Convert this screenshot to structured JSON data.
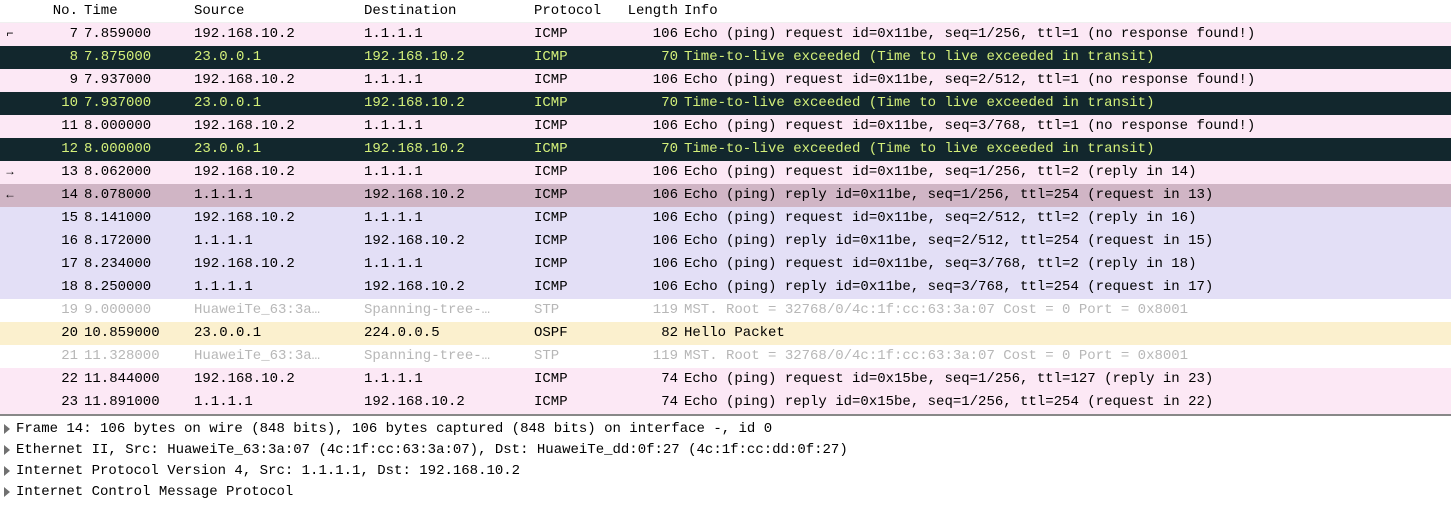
{
  "columns": {
    "no": "No.",
    "time": "Time",
    "source": "Source",
    "destination": "Destination",
    "protocol": "Protocol",
    "length": "Length",
    "info": "Info"
  },
  "rows": [
    {
      "marker": "⌐",
      "no": "7",
      "time": "7.859000",
      "src": "192.168.10.2",
      "dst": "1.1.1.1",
      "proto": "ICMP",
      "len": "106",
      "info": "Echo (ping) request  id=0x11be, seq=1/256, ttl=1 (no response found!)",
      "cls": "bg-pink"
    },
    {
      "marker": "",
      "no": "8",
      "time": "7.875000",
      "src": "23.0.0.1",
      "dst": "192.168.10.2",
      "proto": "ICMP",
      "len": "70",
      "info": "Time-to-live exceeded (Time to live exceeded in transit)",
      "cls": "bg-dark"
    },
    {
      "marker": "",
      "no": "9",
      "time": "7.937000",
      "src": "192.168.10.2",
      "dst": "1.1.1.1",
      "proto": "ICMP",
      "len": "106",
      "info": "Echo (ping) request  id=0x11be, seq=2/512, ttl=1 (no response found!)",
      "cls": "bg-pink"
    },
    {
      "marker": "",
      "no": "10",
      "time": "7.937000",
      "src": "23.0.0.1",
      "dst": "192.168.10.2",
      "proto": "ICMP",
      "len": "70",
      "info": "Time-to-live exceeded (Time to live exceeded in transit)",
      "cls": "bg-dark"
    },
    {
      "marker": "",
      "no": "11",
      "time": "8.000000",
      "src": "192.168.10.2",
      "dst": "1.1.1.1",
      "proto": "ICMP",
      "len": "106",
      "info": "Echo (ping) request  id=0x11be, seq=3/768, ttl=1 (no response found!)",
      "cls": "bg-pink"
    },
    {
      "marker": "",
      "no": "12",
      "time": "8.000000",
      "src": "23.0.0.1",
      "dst": "192.168.10.2",
      "proto": "ICMP",
      "len": "70",
      "info": "Time-to-live exceeded (Time to live exceeded in transit)",
      "cls": "bg-dark"
    },
    {
      "marker": "→",
      "no": "13",
      "time": "8.062000",
      "src": "192.168.10.2",
      "dst": "1.1.1.1",
      "proto": "ICMP",
      "len": "106",
      "info": "Echo (ping) request  id=0x11be, seq=1/256, ttl=2 (reply in 14)",
      "cls": "bg-pink"
    },
    {
      "marker": "←",
      "no": "14",
      "time": "8.078000",
      "src": "1.1.1.1",
      "dst": "192.168.10.2",
      "proto": "ICMP",
      "len": "106",
      "info": "Echo (ping) reply    id=0x11be, seq=1/256, ttl=254 (request in 13)",
      "cls": "bg-mauve"
    },
    {
      "marker": "",
      "no": "15",
      "time": "8.141000",
      "src": "192.168.10.2",
      "dst": "1.1.1.1",
      "proto": "ICMP",
      "len": "106",
      "info": "Echo (ping) request  id=0x11be, seq=2/512, ttl=2 (reply in 16)",
      "cls": "bg-lav"
    },
    {
      "marker": "",
      "no": "16",
      "time": "8.172000",
      "src": "1.1.1.1",
      "dst": "192.168.10.2",
      "proto": "ICMP",
      "len": "106",
      "info": "Echo (ping) reply    id=0x11be, seq=2/512, ttl=254 (request in 15)",
      "cls": "bg-lav"
    },
    {
      "marker": "",
      "no": "17",
      "time": "8.234000",
      "src": "192.168.10.2",
      "dst": "1.1.1.1",
      "proto": "ICMP",
      "len": "106",
      "info": "Echo (ping) request  id=0x11be, seq=3/768, ttl=2 (reply in 18)",
      "cls": "bg-lav"
    },
    {
      "marker": "",
      "no": "18",
      "time": "8.250000",
      "src": "1.1.1.1",
      "dst": "192.168.10.2",
      "proto": "ICMP",
      "len": "106",
      "info": "Echo (ping) reply    id=0x11be, seq=3/768, ttl=254 (request in 17)",
      "cls": "bg-lav"
    },
    {
      "marker": "",
      "no": "19",
      "time": "9.000000",
      "src": "HuaweiTe_63:3a…",
      "dst": "Spanning-tree-…",
      "proto": "STP",
      "len": "119",
      "info": "MST. Root = 32768/0/4c:1f:cc:63:3a:07  Cost = 0  Port = 0x8001",
      "cls": "bg-gray"
    },
    {
      "marker": "",
      "no": "20",
      "time": "10.859000",
      "src": "23.0.0.1",
      "dst": "224.0.0.5",
      "proto": "OSPF",
      "len": "82",
      "info": "Hello Packet",
      "cls": "bg-cream"
    },
    {
      "marker": "",
      "no": "21",
      "time": "11.328000",
      "src": "HuaweiTe_63:3a…",
      "dst": "Spanning-tree-…",
      "proto": "STP",
      "len": "119",
      "info": "MST. Root = 32768/0/4c:1f:cc:63:3a:07  Cost = 0  Port = 0x8001",
      "cls": "bg-gray"
    },
    {
      "marker": "",
      "no": "22",
      "time": "11.844000",
      "src": "192.168.10.2",
      "dst": "1.1.1.1",
      "proto": "ICMP",
      "len": "74",
      "info": "Echo (ping) request  id=0x15be, seq=1/256, ttl=127 (reply in 23)",
      "cls": "bg-pink"
    },
    {
      "marker": "",
      "no": "23",
      "time": "11.891000",
      "src": "1.1.1.1",
      "dst": "192.168.10.2",
      "proto": "ICMP",
      "len": "74",
      "info": "Echo (ping) reply    id=0x15be, seq=1/256, ttl=254 (request in 22)",
      "cls": "bg-pink"
    }
  ],
  "details": [
    "Frame 14: 106 bytes on wire (848 bits), 106 bytes captured (848 bits) on interface -, id 0",
    "Ethernet II, Src: HuaweiTe_63:3a:07 (4c:1f:cc:63:3a:07), Dst: HuaweiTe_dd:0f:27 (4c:1f:cc:dd:0f:27)",
    "Internet Protocol Version 4, Src: 1.1.1.1, Dst: 192.168.10.2",
    "Internet Control Message Protocol"
  ]
}
